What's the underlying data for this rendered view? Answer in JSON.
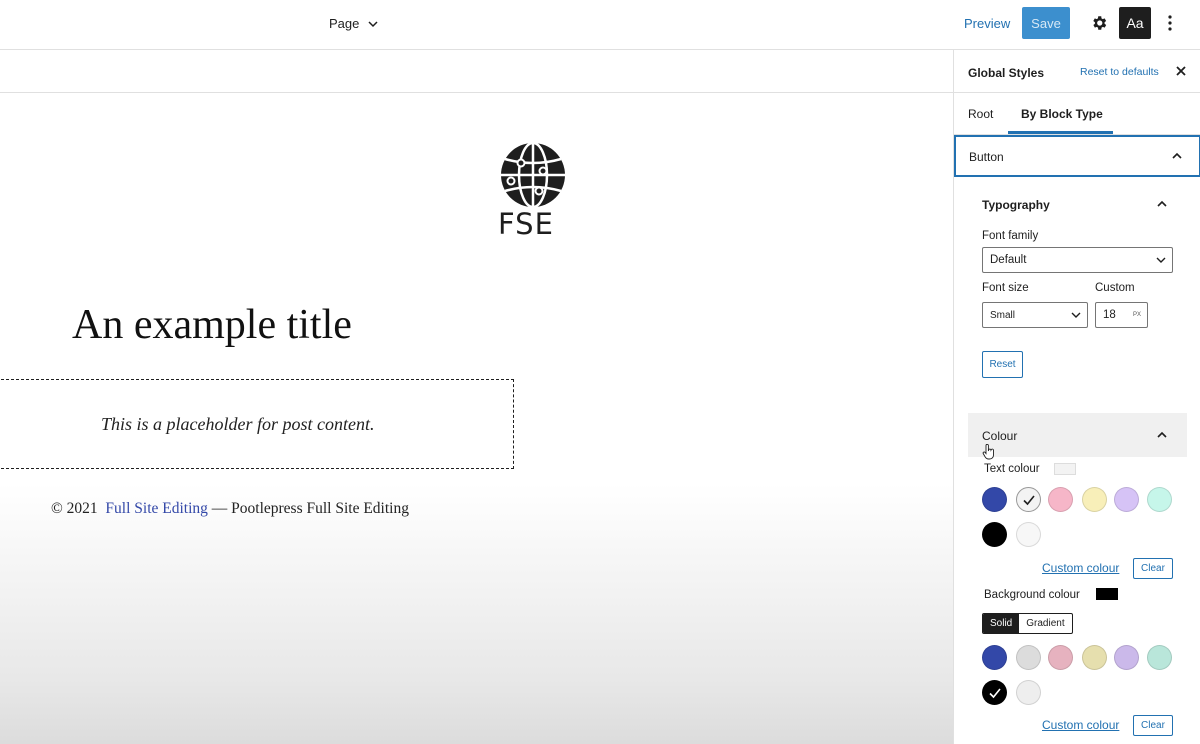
{
  "topbar": {
    "page_label": "Page",
    "preview_label": "Preview",
    "save_label": "Save",
    "styles_button_label": "Aa"
  },
  "canvas": {
    "logo_text": "FSE",
    "title": "An example title",
    "post_placeholder": "This is a placeholder for post content.",
    "footer": {
      "copyright": "© 2021",
      "site_link": "Full Site Editing",
      "tagline": "— Pootlepress Full Site Editing"
    }
  },
  "sidebar": {
    "title": "Global Styles",
    "reset_label": "Reset to defaults",
    "tabs": [
      {
        "label": "Root",
        "active": false
      },
      {
        "label": "By Block Type",
        "active": true
      }
    ],
    "block_panel_title": "Button",
    "typography": {
      "title": "Typography",
      "font_family_label": "Font family",
      "font_family_value": "Default",
      "font_size_label": "Font size",
      "font_size_value": "Small",
      "custom_label": "Custom",
      "custom_value": "18",
      "custom_unit": "PX",
      "reset_label": "Reset"
    },
    "colour": {
      "title": "Colour",
      "text_colour_label": "Text colour",
      "text_colour_value": "#f3f3f3",
      "text_palette": [
        {
          "color": "#3348a8",
          "selected": false
        },
        {
          "color": "#f3f3f3",
          "selected": true
        },
        {
          "color": "#f6b6c8",
          "selected": false
        },
        {
          "color": "#f8efb9",
          "selected": false
        },
        {
          "color": "#d6c3f6",
          "selected": false
        },
        {
          "color": "#c6f6ea",
          "selected": false
        },
        {
          "color": "#000000",
          "selected": false
        },
        {
          "color": "#f7f7f7",
          "selected": false
        }
      ],
      "custom_colour_label": "Custom colour",
      "clear_label": "Clear",
      "background_colour_label": "Background colour",
      "background_colour_value": "#000000",
      "solid_label": "Solid",
      "gradient_label": "Gradient",
      "background_palette": [
        {
          "color": "#3348a8",
          "selected": false
        },
        {
          "color": "#dcdcdc",
          "selected": false
        },
        {
          "color": "#e6b2bf",
          "selected": false
        },
        {
          "color": "#e6dfae",
          "selected": false
        },
        {
          "color": "#cbb9ea",
          "selected": false
        },
        {
          "color": "#b9e6da",
          "selected": false
        },
        {
          "color": "#000000",
          "selected": true
        },
        {
          "color": "#eeeeee",
          "selected": false
        }
      ]
    }
  }
}
